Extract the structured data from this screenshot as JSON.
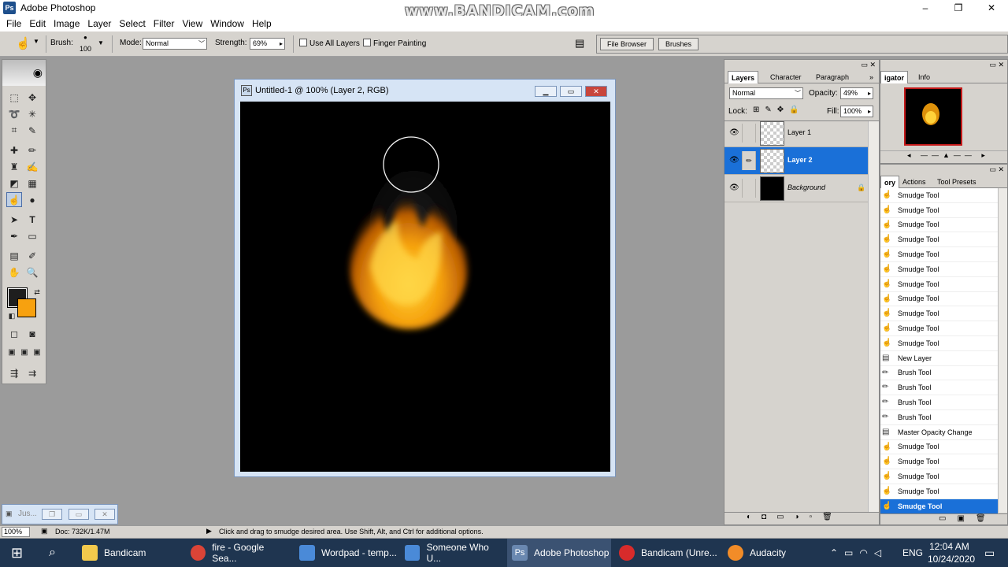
{
  "app": {
    "title": "Adobe Photoshop",
    "watermark": "www.BANDICAM.com"
  },
  "window_controls": {
    "minimize": "–",
    "maximize": "❐",
    "close": "✕"
  },
  "menu": [
    "File",
    "Edit",
    "Image",
    "Layer",
    "Select",
    "Filter",
    "View",
    "Window",
    "Help"
  ],
  "options": {
    "brush_label": "Brush:",
    "brush_size": "100",
    "mode_label": "Mode:",
    "mode_value": "Normal",
    "strength_label": "Strength:",
    "strength_value": "69%",
    "use_all_layers": "Use All Layers",
    "finger_painting": "Finger Painting"
  },
  "palette_well": {
    "tabs": [
      "File Browser",
      "Brushes"
    ]
  },
  "document": {
    "title": "Untitled-1 @ 100% (Layer 2, RGB)"
  },
  "colors": {
    "foreground": "#1e1e1e",
    "background": "#f7a10f",
    "selection": "#1a70d8"
  },
  "layers_panel": {
    "tabs": [
      "Layers",
      "Character",
      "Paragraph"
    ],
    "blend_mode": "Normal",
    "opacity_label": "Opacity:",
    "opacity_value": "49%",
    "lock_label": "Lock:",
    "fill_label": "Fill:",
    "fill_value": "100%",
    "layers": [
      {
        "name": "Layer 1",
        "selected": false
      },
      {
        "name": "Layer 2",
        "selected": true
      },
      {
        "name": "Background",
        "selected": false
      }
    ]
  },
  "navigator_panel": {
    "tabs": [
      "igator",
      "Info"
    ]
  },
  "history_panel": {
    "tabs": [
      "ory",
      "Actions",
      "Tool Presets"
    ],
    "items": [
      "Smudge Tool",
      "Smudge Tool",
      "Smudge Tool",
      "Smudge Tool",
      "Smudge Tool",
      "Smudge Tool",
      "Smudge Tool",
      "Smudge Tool",
      "Smudge Tool",
      "Smudge Tool",
      "Smudge Tool",
      "New Layer",
      "Brush Tool",
      "Brush Tool",
      "Brush Tool",
      "Brush Tool",
      "Master Opacity Change",
      "Smudge Tool",
      "Smudge Tool",
      "Smudge Tool",
      "Smudge Tool",
      "Smudge Tool"
    ]
  },
  "mini_doc": {
    "label": "Jus..."
  },
  "status": {
    "zoom": "100%",
    "doc": "Doc: 732K/1.47M",
    "hint": "Click and drag to smudge desired area.  Use Shift, Alt, and Ctrl for additional options."
  },
  "taskbar": {
    "items": [
      "Bandicam",
      "fire - Google Sea...",
      "Wordpad - temp...",
      "Someone Who U...",
      "Adobe Photoshop",
      "Bandicam (Unre...",
      "Audacity"
    ],
    "language": "ENG",
    "time": "12:04 AM",
    "date": "10/24/2020"
  }
}
